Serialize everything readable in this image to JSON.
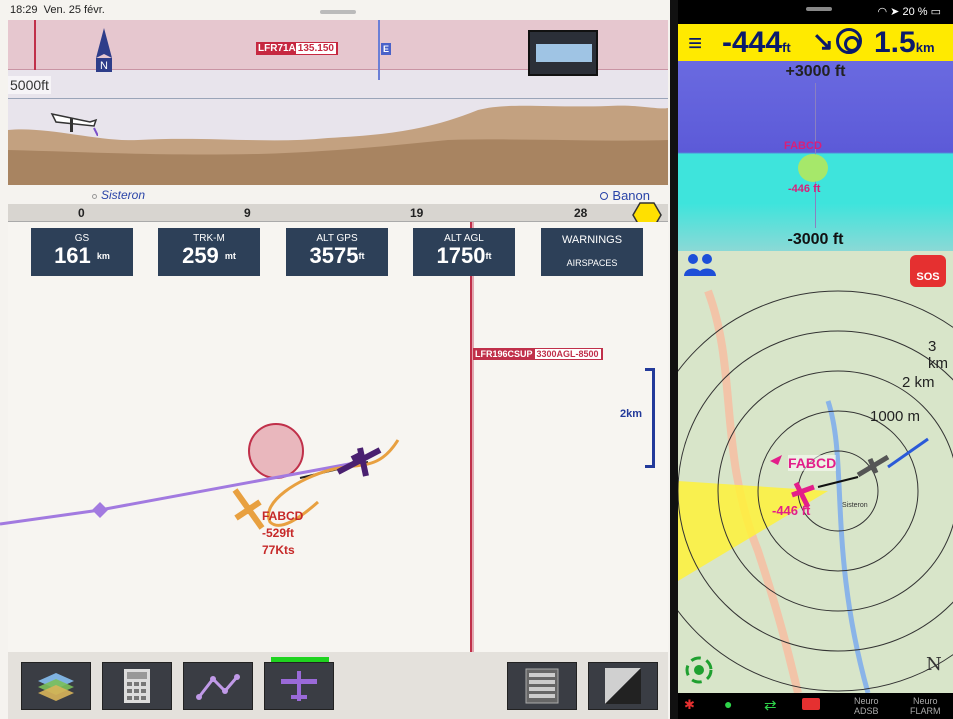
{
  "status_bar": {
    "time": "18:29",
    "date": "Ven. 25 févr."
  },
  "profile": {
    "altitude_label": "5000ft",
    "airspace_name": "LFR71A",
    "airspace_freq": "135.150",
    "airspace_class": "E"
  },
  "route": {
    "from": "Sisteron",
    "to": "Banon",
    "ruler_ticks": [
      "0",
      "9",
      "19",
      "28"
    ]
  },
  "instruments": [
    {
      "label": "GS",
      "value": "161",
      "unit": "km"
    },
    {
      "label": "TRK-M",
      "value": "259",
      "unit": "mt"
    },
    {
      "label": "ALT GPS",
      "value": "3575",
      "unit": "ft"
    },
    {
      "label": "ALT AGL",
      "value": "1750",
      "unit": "ft"
    }
  ],
  "warnings_tile": {
    "label": "WARNINGS",
    "sub": "AIRSPACES"
  },
  "map": {
    "zone_name": "LFR196CSUP",
    "zone_limits": "3300AGL-8500",
    "scale_label": "2km",
    "traffic": {
      "callsign": "FABCD",
      "rel_alt": "-529ft",
      "speed": "77Kts"
    }
  },
  "toolbar": {
    "buttons": [
      "layers-icon",
      "calculator-icon",
      "route-icon",
      "aircraft-icon",
      "list-icon",
      "display-icon"
    ],
    "active": "aircraft-icon"
  },
  "right_status": {
    "battery": "20 %"
  },
  "hud": {
    "vspeed": "-444",
    "vspeed_unit": "ft",
    "distance": "1.5",
    "distance_unit": "km"
  },
  "vertical_profile": {
    "top": "+3000 ft",
    "bottom": "-3000 ft",
    "target_name": "FABCD",
    "target_alt": "-446 ft"
  },
  "radar": {
    "rings": [
      "3 km",
      "2 km",
      "1000 m"
    ],
    "target_name": "FABCD",
    "target_alt": "-446 ft",
    "town": "Sisteron",
    "sos_label": "SOS",
    "north": "N"
  },
  "bottom_bar": {
    "adsb": [
      "Neuro",
      "ADSB"
    ],
    "flarm": [
      "Neuro",
      "FLARM"
    ]
  },
  "colors": {
    "hud_yellow": "#ffea00",
    "traffic_magenta": "#e31e8a",
    "airspace_red": "#c0304a",
    "track_purple": "#a27ae0"
  }
}
